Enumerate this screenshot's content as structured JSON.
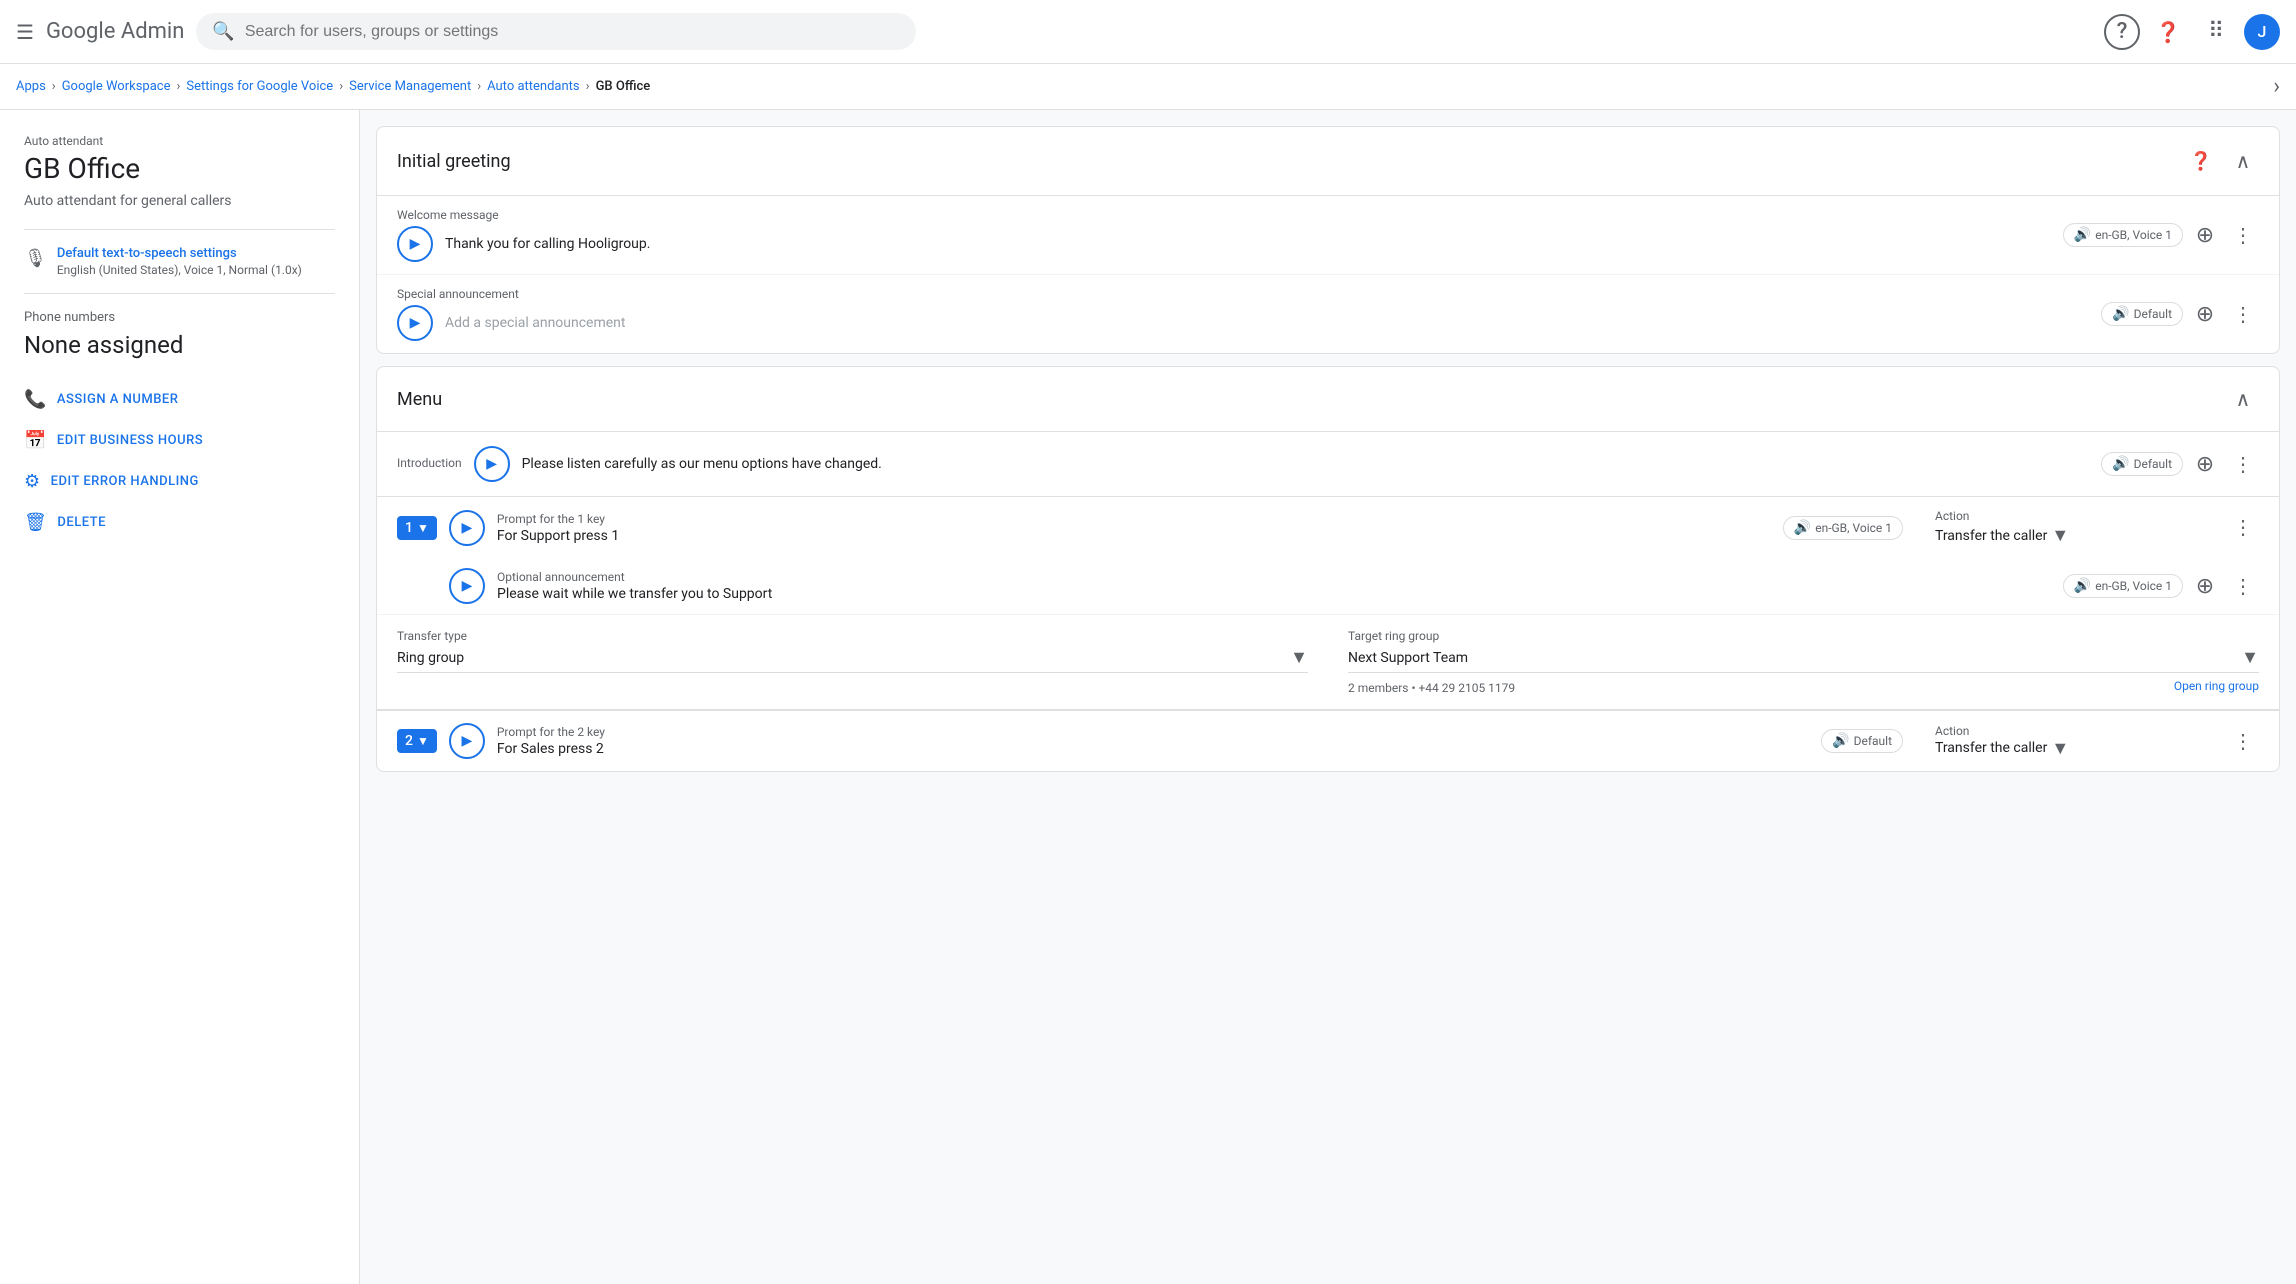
{
  "nav": {
    "menu_icon": "☰",
    "logo_text": "Google Admin",
    "search_placeholder": "Search for users, groups or settings",
    "help_label": "?",
    "apps_icon": "⠿",
    "avatar_letter": "J"
  },
  "breadcrumb": {
    "items": [
      "Apps",
      "Google Workspace",
      "Settings for Google Voice",
      "Service Management",
      "Auto attendants",
      "GB Office"
    ],
    "collapse_icon": "‹"
  },
  "sidebar": {
    "label": "Auto attendant",
    "title": "GB Office",
    "subtitle": "Auto attendant for general callers",
    "tts_label": "Default text-to-speech settings",
    "tts_sub": "English (United States), Voice 1, Normal (1.0x)",
    "phone_label": "Phone numbers",
    "phone_value": "None assigned",
    "assign_label": "ASSIGN A NUMBER",
    "edit_hours_label": "EDIT BUSINESS HOURS",
    "edit_error_label": "EDIT ERROR HANDLING",
    "delete_label": "DELETE"
  },
  "initial_greeting": {
    "title": "Initial greeting",
    "welcome_label": "Welcome message",
    "welcome_text": "Thank you for calling Hooligroup.",
    "welcome_voice": "en-GB, Voice 1",
    "special_label": "Special announcement",
    "special_placeholder": "Add a special announcement",
    "special_voice": "Default"
  },
  "menu": {
    "title": "Menu",
    "intro_label": "Introduction",
    "intro_text": "Please listen carefully as our menu options have changed.",
    "intro_voice": "Default",
    "key1": {
      "key": "1",
      "prompt_label": "Prompt for the 1 key",
      "prompt_text": "For Support press 1",
      "voice": "en-GB, Voice 1",
      "action_label": "Action",
      "action_value": "Transfer the caller",
      "opt_label": "Optional announcement",
      "opt_text": "Please wait while we transfer you to Support",
      "opt_voice": "en-GB, Voice 1",
      "transfer_type_label": "Transfer type",
      "transfer_type_value": "Ring group",
      "target_label": "Target ring group",
      "target_value": "Next Support Team",
      "target_sub": "2 members • +44 29 2105 1179",
      "open_link": "Open ring group"
    },
    "key2": {
      "key": "2",
      "prompt_label": "Prompt for the 2 key",
      "prompt_text": "For Sales press 2",
      "voice": "Default",
      "action_label": "Action",
      "action_value": "Transfer the caller"
    }
  }
}
